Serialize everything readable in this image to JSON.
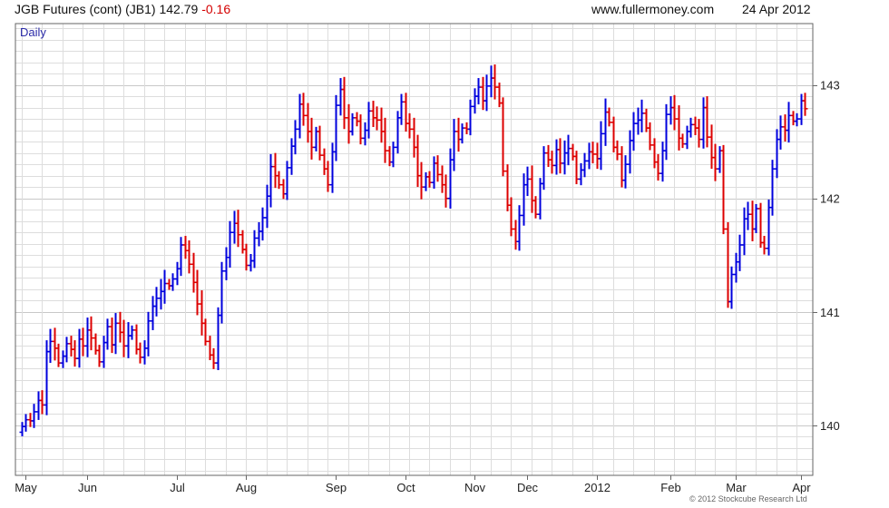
{
  "header": {
    "instrument": "JGB Futures (cont) (JB1)",
    "last": "142.79",
    "change": "-0.16",
    "site": "www.fullermoney.com",
    "date": "24 Apr 2012"
  },
  "footer": {
    "copyright": "© 2012 Stockcube Research Ltd"
  },
  "colors": {
    "up": "#0000dd",
    "down": "#dd0000",
    "grid": "#dddddd",
    "frame": "#666666",
    "label": "#2a2aa8"
  },
  "chart_data": {
    "type": "bar",
    "style": "ohlc-daily",
    "period_label": "Daily",
    "ylim": [
      139.56,
      143.54
    ],
    "yticks": [
      140,
      141,
      142,
      143
    ],
    "grid": true,
    "x_ticks": [
      "May",
      "Jun",
      "Jul",
      "Aug",
      "Sep",
      "Oct",
      "Nov",
      "Dec",
      "2012",
      "Feb",
      "Mar",
      "Apr"
    ],
    "close_series": [
      139.99,
      140.05,
      140.04,
      140.12,
      140.22,
      140.18,
      140.65,
      140.74,
      140.68,
      140.55,
      140.61,
      140.72,
      140.67,
      140.59,
      140.76,
      140.7,
      140.84,
      140.77,
      140.66,
      140.56,
      140.73,
      140.87,
      140.71,
      140.9,
      140.82,
      140.7,
      140.79,
      140.84,
      140.67,
      140.6,
      140.68,
      140.92,
      141.05,
      141.12,
      141.18,
      141.25,
      141.23,
      141.29,
      141.38,
      141.59,
      141.54,
      141.42,
      141.26,
      141.07,
      140.9,
      140.74,
      140.62,
      140.55,
      140.97,
      141.36,
      141.48,
      141.7,
      141.78,
      141.68,
      141.55,
      141.41,
      141.45,
      141.65,
      141.71,
      141.83,
      142.02,
      142.28,
      142.2,
      142.12,
      142.04,
      142.27,
      142.46,
      142.61,
      142.83,
      142.73,
      142.59,
      142.45,
      142.59,
      142.38,
      142.26,
      142.12,
      142.41,
      142.82,
      142.96,
      142.71,
      142.59,
      142.71,
      142.68,
      142.53,
      142.6,
      142.77,
      142.71,
      142.69,
      142.59,
      142.42,
      142.32,
      142.45,
      142.71,
      142.85,
      142.66,
      142.61,
      142.45,
      142.2,
      142.1,
      142.19,
      142.14,
      142.31,
      142.21,
      142.12,
      142.0,
      142.34,
      142.59,
      142.52,
      142.62,
      142.61,
      142.81,
      142.9,
      142.98,
      142.86,
      142.99,
      143.06,
      142.98,
      142.84,
      142.24,
      141.94,
      141.73,
      141.62,
      141.85,
      142.12,
      142.17,
      141.98,
      141.86,
      142.13,
      142.4,
      142.34,
      142.29,
      142.43,
      142.31,
      142.4,
      142.44,
      142.37,
      142.17,
      142.25,
      142.33,
      142.41,
      142.39,
      142.35,
      142.57,
      142.76,
      142.67,
      142.45,
      142.39,
      142.16,
      142.3,
      142.51,
      142.66,
      142.69,
      142.75,
      142.62,
      142.47,
      142.32,
      142.22,
      142.42,
      142.74,
      142.8,
      142.7,
      142.53,
      142.48,
      142.59,
      142.65,
      142.62,
      142.52,
      142.8,
      142.54,
      142.36,
      142.26,
      142.42,
      141.73,
      141.09,
      141.33,
      141.44,
      141.59,
      141.82,
      141.86,
      141.73,
      141.91,
      141.61,
      141.56,
      141.92,
      142.26,
      142.52,
      142.63,
      142.6,
      142.73,
      142.68,
      142.7,
      142.86,
      142.79
    ]
  }
}
